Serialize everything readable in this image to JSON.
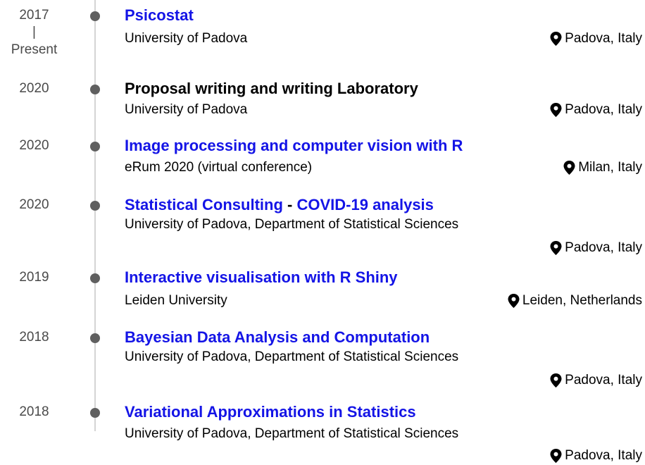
{
  "entries": [
    {
      "date_start": "2017",
      "date_sep": "|",
      "date_end": "Present",
      "title": "Psicostat",
      "title_link": true,
      "org": "University of Padova",
      "location": "Padova, Italy"
    },
    {
      "date": "2020",
      "title": "Proposal writing and writing Laboratory",
      "title_link": false,
      "org": "University of Padova",
      "location": "Padova, Italy"
    },
    {
      "date": "2020",
      "title": "Image processing and computer vision with R",
      "title_link": true,
      "org": "eRum 2020 (virtual conference)",
      "location": "Milan, Italy"
    },
    {
      "date": "2020",
      "title_part1": "Statistical Consulting",
      "title_sep": " - ",
      "title_part2": "COVID-19 analysis",
      "title_link": true,
      "org": "University of Padova, Department of Statistical Sciences",
      "location": "Padova, Italy"
    },
    {
      "date": "2019",
      "title": "Interactive visualisation with R Shiny",
      "title_link": true,
      "org": "Leiden University",
      "location": "Leiden, Netherlands"
    },
    {
      "date": "2018",
      "title": "Bayesian Data Analysis and Computation",
      "title_link": true,
      "org": "University of Padova, Department of Statistical Sciences",
      "location": "Padova, Italy"
    },
    {
      "date": "2018",
      "title": "Variational Approximations in Statistics",
      "title_link": true,
      "org": "University of Padova, Department of Statistical Sciences",
      "location": "Padova, Italy"
    }
  ],
  "icons": {
    "location": "map-pin-icon"
  },
  "colors": {
    "link": "#1414e6",
    "dot": "#5f5f5f",
    "line": "#d4d4d4",
    "date": "#4a4a4a"
  }
}
